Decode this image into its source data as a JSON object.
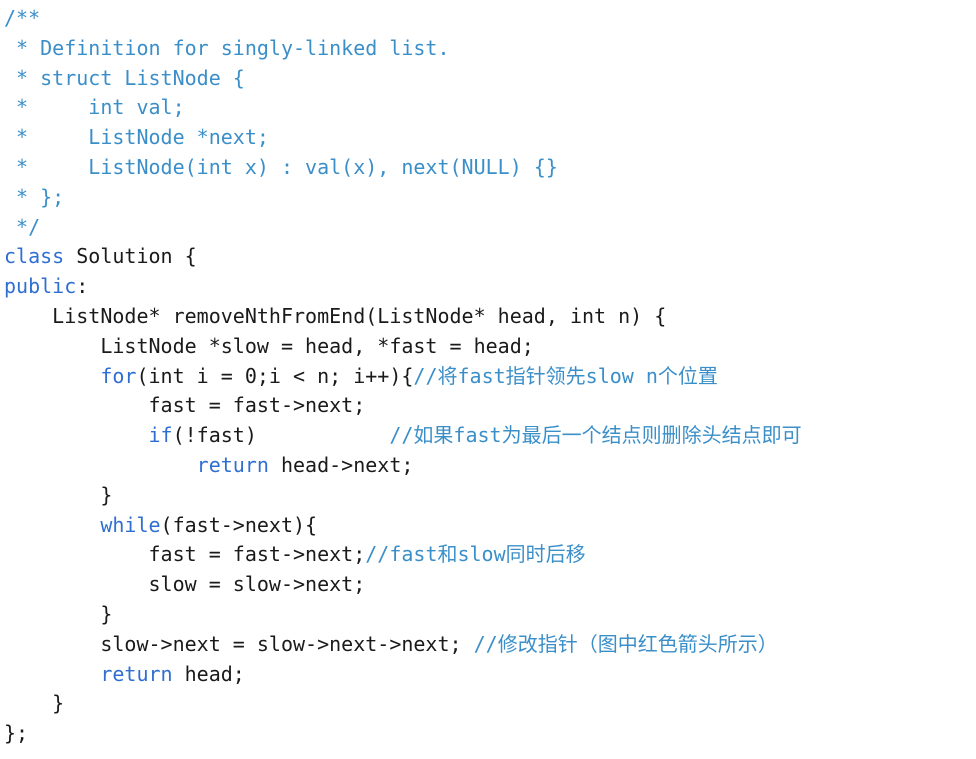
{
  "editor": {
    "colors": {
      "background": "#ffffff",
      "comment": "#3b8fc9",
      "keyword": "#2f6fd1",
      "text": "#1a1a1a"
    },
    "lines": [
      [
        {
          "t": "/**",
          "c": "cmt"
        }
      ],
      [
        {
          "t": " * Definition for singly-linked list.",
          "c": "cmt"
        }
      ],
      [
        {
          "t": " * struct ListNode {",
          "c": "cmt"
        }
      ],
      [
        {
          "t": " *     int val;",
          "c": "cmt"
        }
      ],
      [
        {
          "t": " *     ListNode *next;",
          "c": "cmt"
        }
      ],
      [
        {
          "t": " *     ListNode(int x) : val(x), next(NULL) {}",
          "c": "cmt"
        }
      ],
      [
        {
          "t": " * };",
          "c": "cmt"
        }
      ],
      [
        {
          "t": " */",
          "c": "cmt"
        }
      ],
      [
        {
          "t": "class",
          "c": "kw"
        },
        {
          "t": " Solution {",
          "c": "txt"
        }
      ],
      [
        {
          "t": "public",
          "c": "kw"
        },
        {
          "t": ":",
          "c": "txt"
        }
      ],
      [
        {
          "t": "    ListNode* removeNthFromEnd(ListNode* head, ",
          "c": "txt"
        },
        {
          "t": "int",
          "c": "txt"
        },
        {
          "t": " n) {",
          "c": "txt"
        }
      ],
      [
        {
          "t": "        ListNode *slow = head, *fast = head;",
          "c": "txt"
        }
      ],
      [
        {
          "t": "        ",
          "c": "txt"
        },
        {
          "t": "for",
          "c": "kw"
        },
        {
          "t": "(int i = 0;i < n; i++){",
          "c": "txt"
        },
        {
          "t": "//将fast指针领先slow n个位置",
          "c": "cmt"
        }
      ],
      [
        {
          "t": "            fast = fast->next;",
          "c": "txt"
        }
      ],
      [
        {
          "t": "            ",
          "c": "txt"
        },
        {
          "t": "if",
          "c": "kw"
        },
        {
          "t": "(!fast)           ",
          "c": "txt"
        },
        {
          "t": "//如果fast为最后一个结点则删除头结点即可",
          "c": "cmt"
        }
      ],
      [
        {
          "t": "                ",
          "c": "txt"
        },
        {
          "t": "return",
          "c": "kw"
        },
        {
          "t": " head->next;",
          "c": "txt"
        }
      ],
      [
        {
          "t": "        }",
          "c": "txt"
        }
      ],
      [
        {
          "t": "        ",
          "c": "txt"
        },
        {
          "t": "while",
          "c": "kw"
        },
        {
          "t": "(fast->next){",
          "c": "txt"
        }
      ],
      [
        {
          "t": "            fast = fast->next;",
          "c": "txt"
        },
        {
          "t": "//fast和slow同时后移",
          "c": "cmt"
        }
      ],
      [
        {
          "t": "            slow = slow->next;",
          "c": "txt"
        }
      ],
      [
        {
          "t": "        }",
          "c": "txt"
        }
      ],
      [
        {
          "t": "        slow->next = slow->next->next; ",
          "c": "txt"
        },
        {
          "t": "//修改指针（图中红色箭头所示）",
          "c": "cmt"
        }
      ],
      [
        {
          "t": "        ",
          "c": "txt"
        },
        {
          "t": "return",
          "c": "kw"
        },
        {
          "t": " head;",
          "c": "txt"
        }
      ],
      [
        {
          "t": "    }",
          "c": "txt"
        }
      ],
      [
        {
          "t": "};",
          "c": "txt"
        }
      ]
    ]
  }
}
